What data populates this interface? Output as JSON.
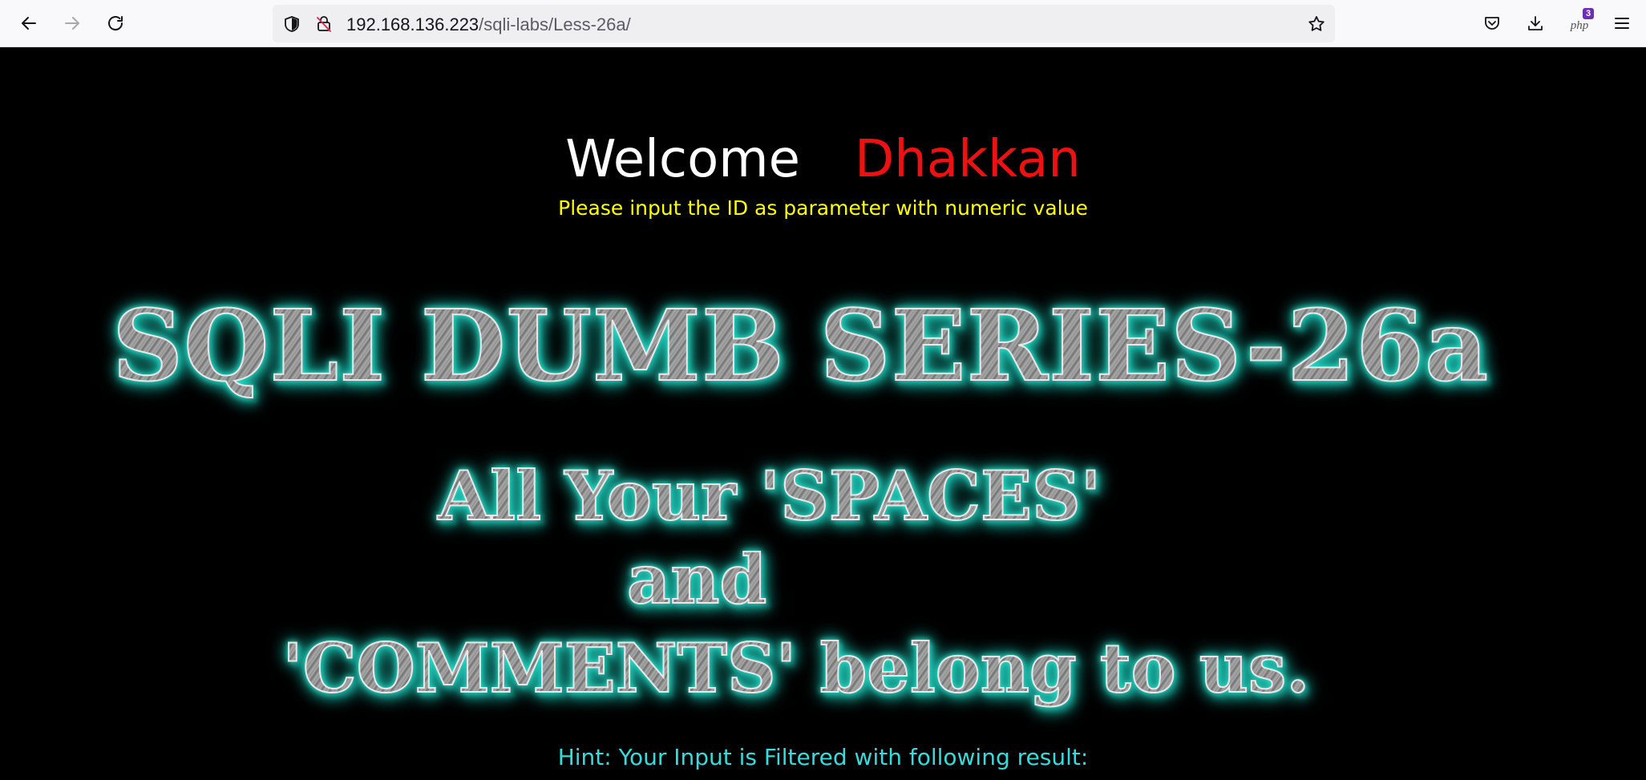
{
  "browser": {
    "url_host": "192.168.136.223",
    "url_path": "/sqli-labs/Less-26a/",
    "extension_badge_count": "3",
    "extension_label": "php",
    "icons": {
      "back": "back-arrow-icon",
      "forward": "forward-arrow-icon",
      "reload": "reload-icon",
      "tracking": "shield-icon",
      "insecure": "insecure-lock-icon",
      "bookmark": "star-icon",
      "pocket": "pocket-icon",
      "downloads": "download-icon",
      "extension": "php-extension-icon",
      "menu": "hamburger-menu-icon"
    }
  },
  "page": {
    "welcome_word": "Welcome",
    "welcome_name": "Dhakkan",
    "instruction": "Please input the ID as parameter with numeric value",
    "title_banner": "SQLI DUMB SERIES-26a",
    "slogan_line1": "All Your 'SPACES'",
    "slogan_line2": "and",
    "slogan_line3": "'COMMENTS' belong to us.",
    "hint": "Hint: Your Input is Filtered with following result:",
    "colors": {
      "background": "#000000",
      "welcome": "#ffffff",
      "name": "#ee1111",
      "instruction": "#ffff00",
      "hint": "#33dddd",
      "glow": "#2ee6d2"
    }
  }
}
